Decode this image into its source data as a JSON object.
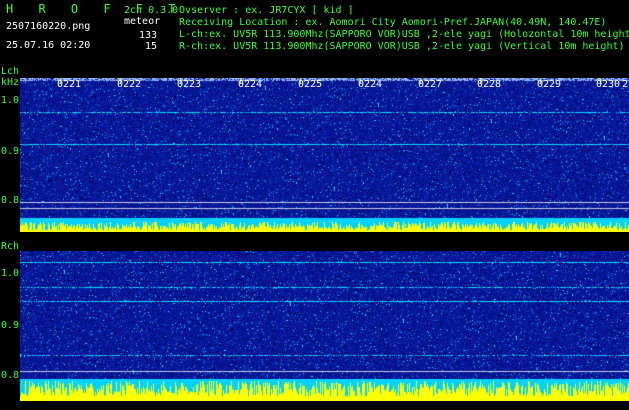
{
  "header": {
    "logo": "H R O F F T",
    "filename": "2507160220.png",
    "datetime": "25.07.16 02:20",
    "mode": "2ch 0.3.0",
    "type_label": "meteor",
    "count_l": "133",
    "count_r": "15",
    "observer": "Ovserver            : ex. JR7CYX [ kid ]",
    "location": "Receiving Location : ex. Aomori City Aomori-Pref.JAPAN(40.49N, 140.47E)",
    "lch_info": "L-ch:ex. UV5R 113.900Mhz(SAPPORO VOR)USB ,2-ele yagi (Holozontal 10m height)",
    "rch_info": "R-ch:ex. UV5R 113.900Mhz(SAPPORO VOR)USB ,2-ele yagi (Vertical 10m height)"
  },
  "lch": {
    "label": "Lch",
    "unit": "kHz",
    "yticks": [
      "1.0",
      "0.9",
      "0.8"
    ],
    "time_marks": [
      "0221",
      "0222",
      "0223",
      "0224",
      "0225",
      "0224",
      "0227",
      "0228",
      "0229",
      "0230"
    ],
    "time_end": "2"
  },
  "rch": {
    "label": "Rch",
    "yticks": [
      "1.0",
      "0.9",
      "0.8"
    ]
  },
  "colors": {
    "text_green": "#36ff36",
    "tick_yellow": "#ffff00",
    "spectrum_bg": "#0a1a9c",
    "noise_cyan": "#00e0ff",
    "amplitude_yellow": "#ffff00"
  }
}
